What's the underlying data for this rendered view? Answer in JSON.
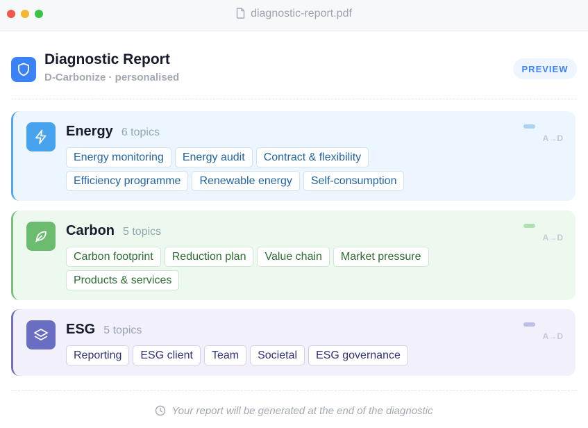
{
  "window": {
    "title": "diagnostic-report.pdf",
    "file_icon": "document-icon"
  },
  "header": {
    "title": "Diagnostic Report",
    "subtitle": "D-Carbonize · personalised",
    "icon": "shield-icon",
    "preview_label": "PREVIEW"
  },
  "categories": [
    {
      "name": "Energy",
      "count": "6 topics",
      "icon": "lightning-icon",
      "accent": "#47a3ee",
      "range": "A→D",
      "topics": [
        "Energy monitoring",
        "Energy audit",
        "Contract & flexibility",
        "Efficiency programme",
        "Renewable energy",
        "Self-consumption"
      ]
    },
    {
      "name": "Carbon",
      "count": "5 topics",
      "icon": "leaf-icon",
      "accent": "#6cbc70",
      "range": "A→D",
      "topics": [
        "Carbon footprint",
        "Reduction plan",
        "Value chain",
        "Market pressure",
        "Products & services"
      ]
    },
    {
      "name": "ESG",
      "count": "5 topics",
      "icon": "layers-icon",
      "accent": "#6a6ec3",
      "range": "A→D",
      "topics": [
        "Reporting",
        "ESG client",
        "Team",
        "Societal",
        "ESG governance"
      ]
    }
  ],
  "footer": {
    "note": "Your report will be generated at the end of the diagnostic",
    "icon": "clock-icon"
  }
}
